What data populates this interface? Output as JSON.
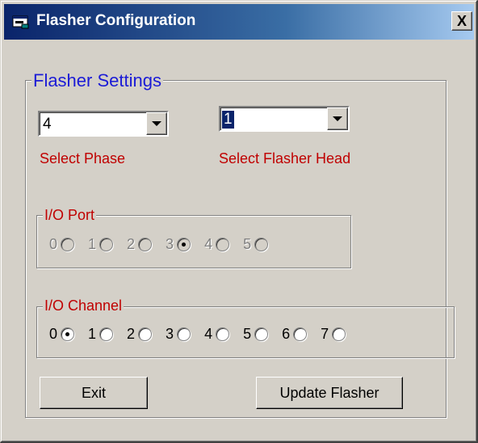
{
  "window": {
    "title": "Flasher Configuration",
    "close_label": "X"
  },
  "settings": {
    "legend": "Flasher Settings",
    "phase_value": "4",
    "phase_label": "Select Phase",
    "head_value": "1",
    "head_label": "Select Flasher Head"
  },
  "io_port": {
    "legend": "I/O Port",
    "options": [
      "0",
      "1",
      "2",
      "3",
      "4",
      "5"
    ],
    "selected": "3",
    "enabled": false
  },
  "io_channel": {
    "legend": "I/O Channel",
    "options": [
      "0",
      "1",
      "2",
      "3",
      "4",
      "5",
      "6",
      "7"
    ],
    "selected": "0"
  },
  "buttons": {
    "exit_label": "Exit",
    "update_label": "Update Flasher"
  },
  "colors": {
    "title_bar": "#0a246a",
    "legend_blue": "#1b1bd6",
    "label_red": "#c00000",
    "face": "#d4d0c8"
  },
  "icons": {
    "title": "app-icon",
    "close": "close-icon",
    "dropdown": "chevron-down-icon"
  }
}
